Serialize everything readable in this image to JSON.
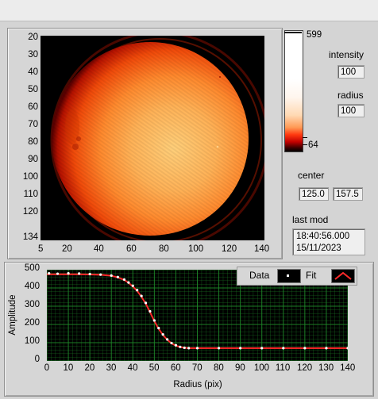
{
  "image_panel": {
    "y_ticks": [
      "20",
      "30",
      "40",
      "50",
      "60",
      "70",
      "80",
      "90",
      "100",
      "110",
      "120",
      "134"
    ],
    "x_ticks": [
      "5",
      "20",
      "40",
      "60",
      "80",
      "100",
      "120",
      "140"
    ]
  },
  "colorbar": {
    "max_label": "599",
    "min_label": "64"
  },
  "controls": {
    "intensity_label": "intensity",
    "intensity_value": "100",
    "radius_label": "radius",
    "radius_value": "100",
    "center_label": "center",
    "center_x": "125.0",
    "center_y": "157.5",
    "last_mod_label": "last mod",
    "last_mod_time": "18:40:56.000",
    "last_mod_date": "15/11/2023"
  },
  "legend": {
    "data_label": "Data",
    "fit_label": "Fit"
  },
  "colors": {
    "data_marker": "#ffffff",
    "fit_line": "#ff2a2a",
    "grid": "#1f8a2a",
    "plot_bg": "#000000"
  },
  "chart_data": {
    "type": "scatter",
    "xlabel": "Radius (pix)",
    "ylabel": "Amplitude",
    "xlim": [
      0,
      140
    ],
    "ylim": [
      0,
      500
    ],
    "x_ticks": [
      "0",
      "10",
      "20",
      "30",
      "40",
      "50",
      "60",
      "70",
      "80",
      "90",
      "100",
      "110",
      "120",
      "130",
      "140"
    ],
    "y_ticks": [
      "0",
      "100",
      "200",
      "300",
      "400",
      "500"
    ],
    "grid": true,
    "legend_position": "top-right",
    "series": [
      {
        "name": "Data",
        "style": "markers",
        "x": [
          1,
          5,
          10,
          15,
          20,
          25,
          30,
          33,
          36,
          38,
          40,
          42,
          44,
          46,
          48,
          50,
          52,
          54,
          56,
          58,
          60,
          62,
          64,
          66,
          70,
          80,
          90,
          100,
          110,
          120,
          130,
          140
        ],
        "y": [
          480,
          478,
          480,
          479,
          476,
          473,
          468,
          460,
          446,
          430,
          412,
          388,
          356,
          318,
          272,
          222,
          180,
          145,
          118,
          98,
          86,
          77,
          72,
          70,
          70,
          70,
          70,
          70,
          70,
          70,
          70,
          70
        ]
      },
      {
        "name": "Fit",
        "style": "line",
        "x": [
          0,
          5,
          10,
          15,
          20,
          25,
          30,
          33,
          36,
          38,
          40,
          42,
          44,
          46,
          48,
          50,
          52,
          54,
          56,
          58,
          60,
          62,
          64,
          66,
          70,
          80,
          90,
          100,
          110,
          120,
          130,
          140
        ],
        "y": [
          475,
          475,
          475,
          475,
          474,
          472,
          467,
          458,
          444,
          428,
          408,
          384,
          352,
          314,
          268,
          218,
          176,
          142,
          116,
          96,
          84,
          76,
          72,
          70,
          70,
          70,
          70,
          70,
          70,
          70,
          70,
          70
        ]
      }
    ]
  }
}
